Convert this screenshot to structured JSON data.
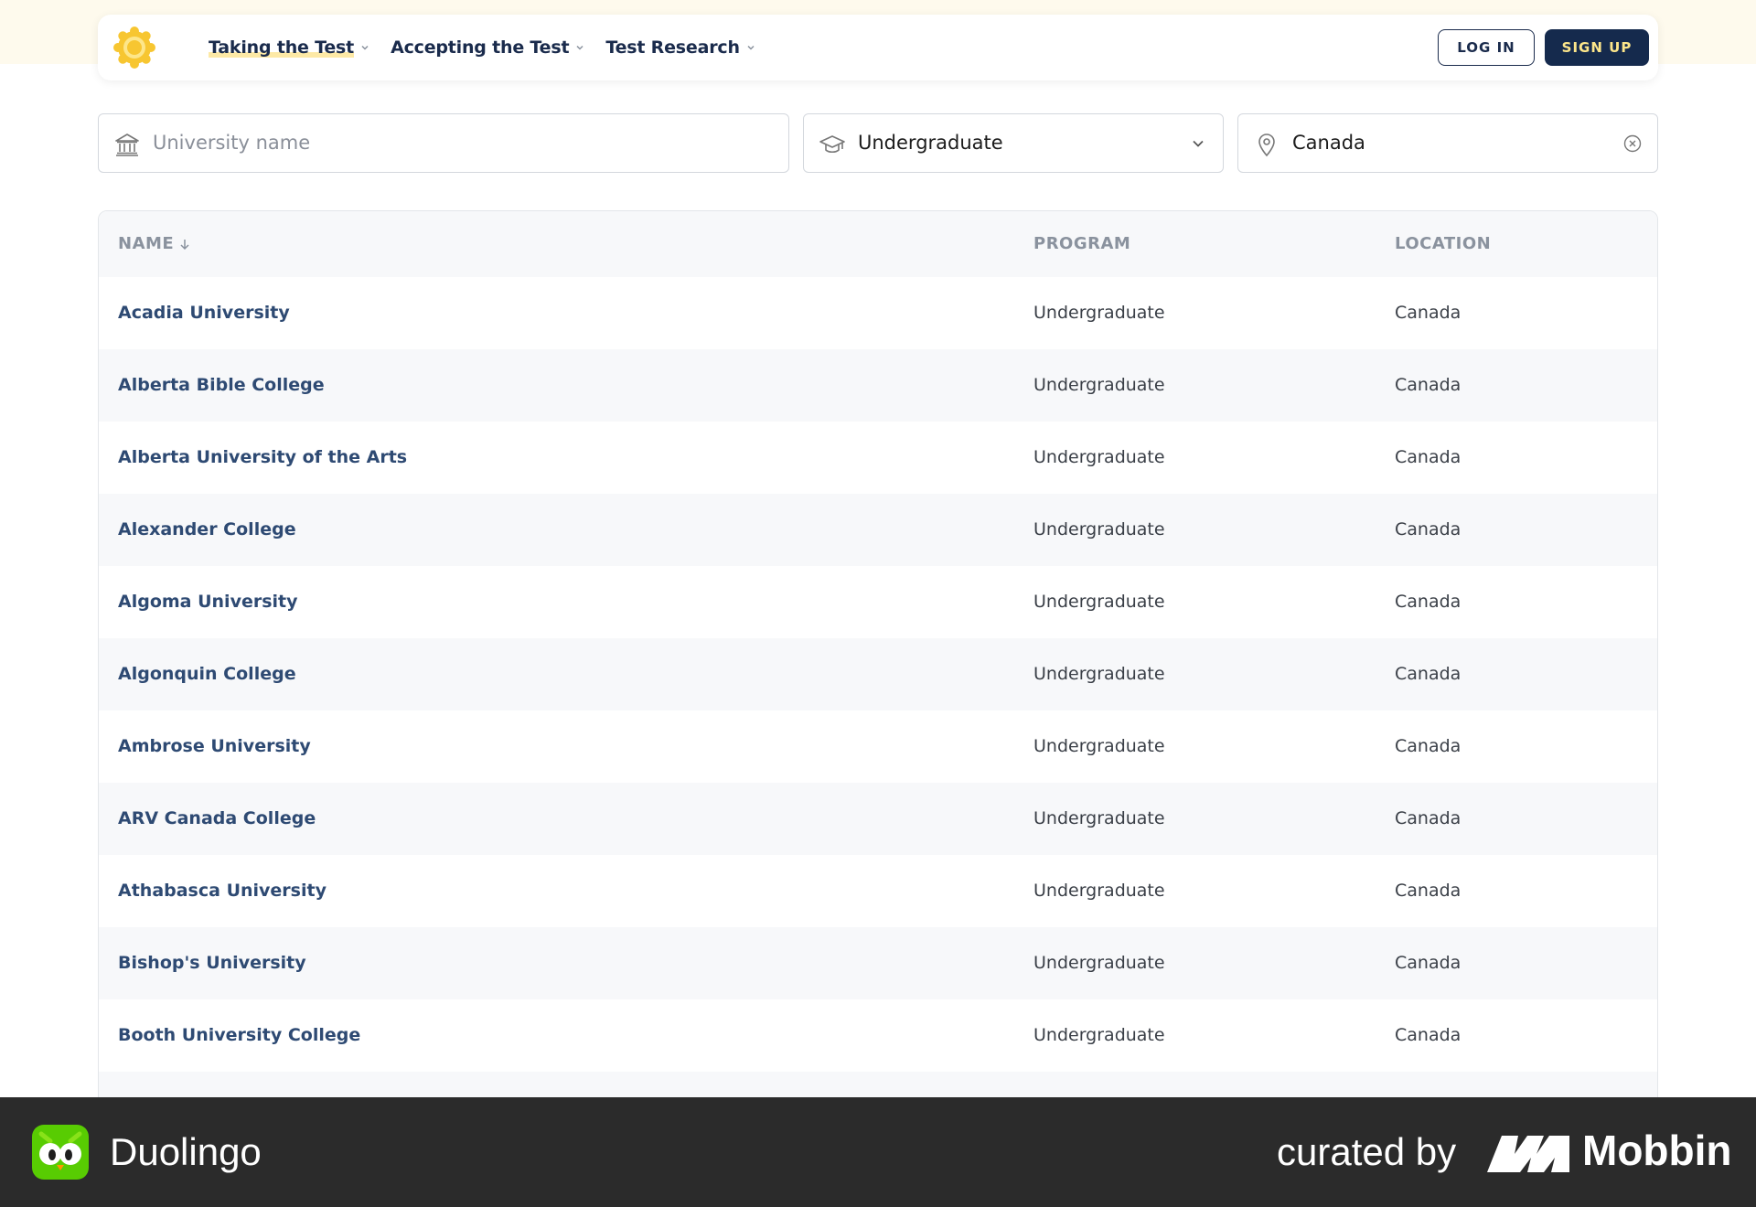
{
  "nav": {
    "items": [
      {
        "label": "Taking the Test",
        "active": true
      },
      {
        "label": "Accepting the Test",
        "active": false
      },
      {
        "label": "Test Research",
        "active": false
      }
    ],
    "login_label": "LOG IN",
    "signup_label": "SIGN UP"
  },
  "filters": {
    "name_placeholder": "University name",
    "name_value": "",
    "program_value": "Undergraduate",
    "location_value": "Canada"
  },
  "table": {
    "headers": {
      "name": "NAME",
      "program": "PROGRAM",
      "location": "LOCATION"
    },
    "sort": "ascending",
    "rows": [
      {
        "name": "Acadia University",
        "program": "Undergraduate",
        "location": "Canada"
      },
      {
        "name": "Alberta Bible College",
        "program": "Undergraduate",
        "location": "Canada"
      },
      {
        "name": "Alberta University of the Arts",
        "program": "Undergraduate",
        "location": "Canada"
      },
      {
        "name": "Alexander College",
        "program": "Undergraduate",
        "location": "Canada"
      },
      {
        "name": "Algoma University",
        "program": "Undergraduate",
        "location": "Canada"
      },
      {
        "name": "Algonquin College",
        "program": "Undergraduate",
        "location": "Canada"
      },
      {
        "name": "Ambrose University",
        "program": "Undergraduate",
        "location": "Canada"
      },
      {
        "name": "ARV Canada College",
        "program": "Undergraduate",
        "location": "Canada"
      },
      {
        "name": "Athabasca University",
        "program": "Undergraduate",
        "location": "Canada"
      },
      {
        "name": "Bishop's University",
        "program": "Undergraduate",
        "location": "Canada"
      },
      {
        "name": "Booth University College",
        "program": "Undergraduate",
        "location": "Canada"
      }
    ]
  },
  "footer": {
    "app_name": "Duolingo",
    "curated_label": "curated by",
    "curator_name": "Mobbin"
  },
  "colors": {
    "navy": "#152a4d",
    "accent_yellow": "#fde68a",
    "link_blue": "#2e4a73",
    "duo_green": "#58cc02"
  }
}
